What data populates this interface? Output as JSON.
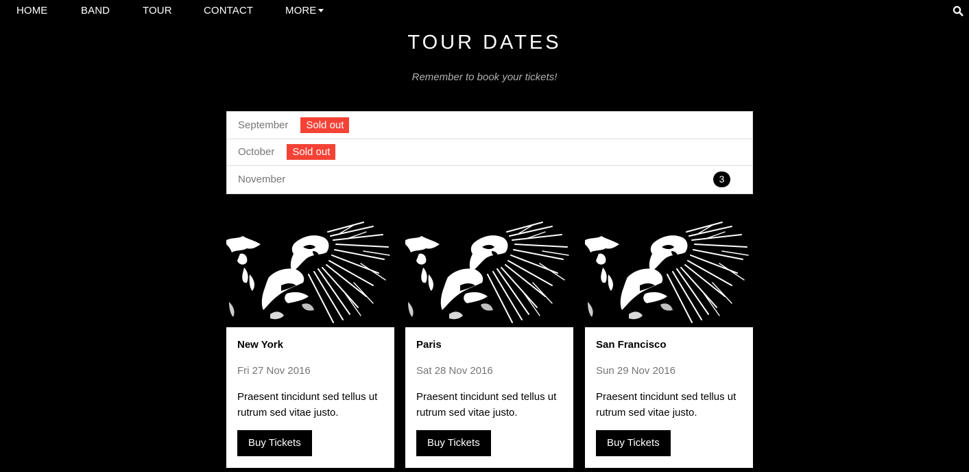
{
  "nav": {
    "items": [
      {
        "label": "HOME"
      },
      {
        "label": "BAND"
      },
      {
        "label": "TOUR"
      },
      {
        "label": "CONTACT"
      },
      {
        "label": "MORE"
      }
    ],
    "search_icon": "search-icon"
  },
  "header": {
    "title": "TOUR DATES",
    "subtitle": "Remember to book your tickets!"
  },
  "months": [
    {
      "name": "September",
      "tag": "Sold out"
    },
    {
      "name": "October",
      "tag": "Sold out"
    },
    {
      "name": "November",
      "badge": "3"
    }
  ],
  "cards": [
    {
      "city": "New York",
      "date": "Fri 27 Nov 2016",
      "text": "Praesent tincidunt sed tellus ut rutrum sed vitae justo.",
      "button": "Buy Tickets"
    },
    {
      "city": "Paris",
      "date": "Sat 28 Nov 2016",
      "text": "Praesent tincidunt sed tellus ut rutrum sed vitae justo.",
      "button": "Buy Tickets"
    },
    {
      "city": "San Francisco",
      "date": "Sun 29 Nov 2016",
      "text": "Praesent tincidunt sed tellus ut rutrum sed vitae justo.",
      "button": "Buy Tickets"
    }
  ],
  "colors": {
    "background": "#000000",
    "sold_out": "#f44336",
    "muted_text": "#757575"
  }
}
